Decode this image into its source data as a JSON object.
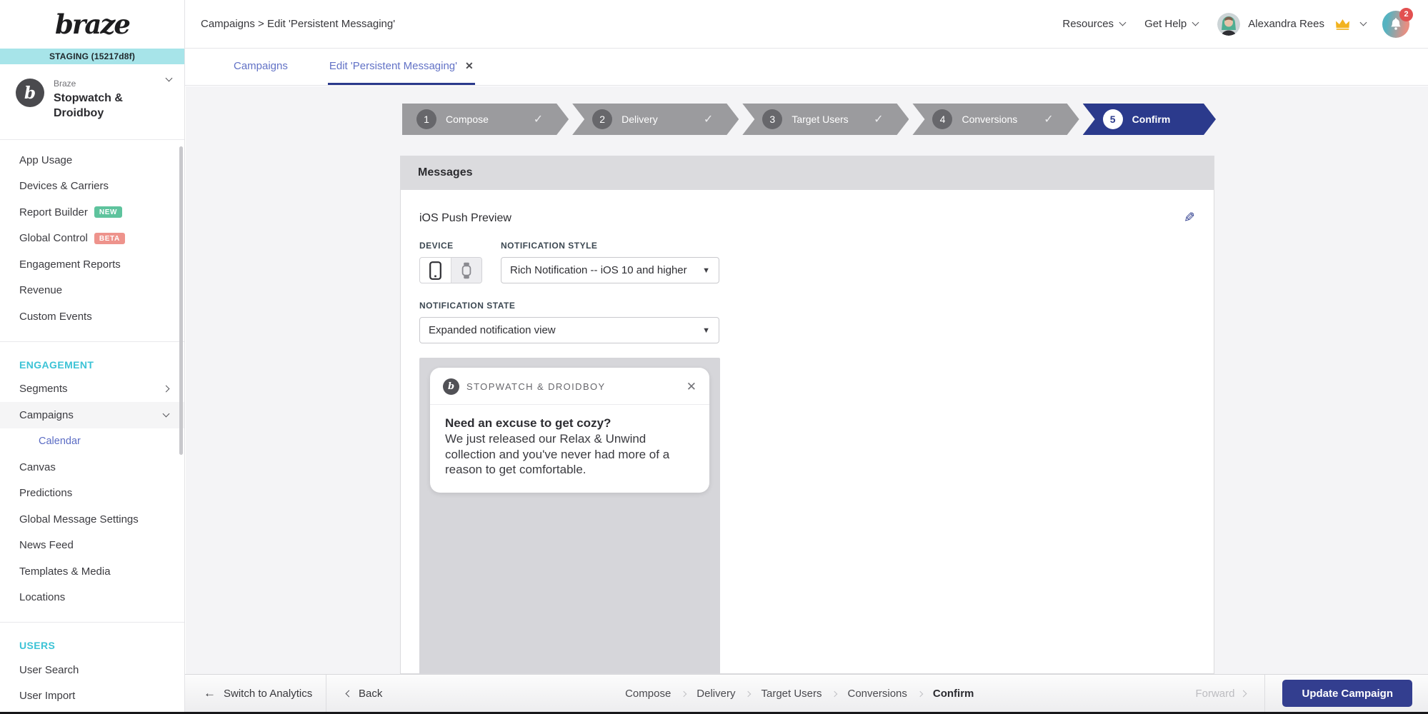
{
  "brand": {
    "logo_text": "braze",
    "env_badge": "STAGING (15217d8f)"
  },
  "workspace": {
    "org": "Braze",
    "app_group": "Stopwatch & Droidboy",
    "avatar_letter": "b"
  },
  "header": {
    "breadcrumb": "Campaigns > Edit 'Persistent Messaging'",
    "resources_label": "Resources",
    "get_help_label": "Get Help",
    "user_name": "Alexandra Rees",
    "notification_count": "2"
  },
  "tabs": [
    {
      "label": "Campaigns",
      "active": false
    },
    {
      "label": "Edit 'Persistent Messaging'",
      "active": true
    }
  ],
  "wizard": {
    "steps": [
      {
        "num": "1",
        "label": "Compose",
        "state": "done"
      },
      {
        "num": "2",
        "label": "Delivery",
        "state": "done"
      },
      {
        "num": "3",
        "label": "Target Users",
        "state": "done"
      },
      {
        "num": "4",
        "label": "Conversions",
        "state": "done"
      },
      {
        "num": "5",
        "label": "Confirm",
        "state": "active"
      }
    ]
  },
  "sidebar": {
    "analytics": [
      {
        "label": "App Usage"
      },
      {
        "label": "Devices & Carriers"
      },
      {
        "label": "Report Builder",
        "badge": "NEW"
      },
      {
        "label": "Global Control",
        "badge": "BETA"
      },
      {
        "label": "Engagement Reports"
      },
      {
        "label": "Revenue"
      },
      {
        "label": "Custom Events"
      }
    ],
    "engagement_header": "ENGAGEMENT",
    "engagement": [
      {
        "label": "Segments"
      },
      {
        "label": "Campaigns",
        "active": true
      },
      {
        "label": "Calendar",
        "sub": true
      },
      {
        "label": "Canvas"
      },
      {
        "label": "Predictions"
      },
      {
        "label": "Global Message Settings"
      },
      {
        "label": "News Feed"
      },
      {
        "label": "Templates & Media"
      },
      {
        "label": "Locations"
      }
    ],
    "users_header": "USERS",
    "users": [
      {
        "label": "User Search"
      },
      {
        "label": "User Import"
      }
    ]
  },
  "messages_panel": {
    "title": "Messages",
    "preview_title": "iOS Push Preview",
    "device_label": "DEVICE",
    "notification_style_label": "NOTIFICATION STYLE",
    "notification_style_value": "Rich Notification -- iOS 10 and higher",
    "notification_state_label": "NOTIFICATION STATE",
    "notification_state_value": "Expanded notification view",
    "push_preview": {
      "app_name": "STOPWATCH & DROIDBOY",
      "title": "Need an excuse to get cozy?",
      "body": "We just released our Relax & Unwind collection and you've never had more of a reason to get comfortable."
    }
  },
  "footer": {
    "switch_label": "Switch to Analytics",
    "back_label": "Back",
    "steps": [
      "Compose",
      "Delivery",
      "Target Users",
      "Conversions",
      "Confirm"
    ],
    "active_step": "Confirm",
    "forward_label": "Forward",
    "update_label": "Update Campaign"
  },
  "icons": {
    "check": "✓",
    "close": "✕",
    "caret_down": "▼",
    "arrow_left": "←",
    "pencil": "✎"
  },
  "colors": {
    "primary_navy": "#2b3a8c",
    "link_blue": "#6272c6",
    "teal_header": "#3cc3d6",
    "staging_bg": "#a7e4e9",
    "badge_new": "#5ec39d",
    "badge_beta": "#ee938c",
    "wizard_gray": "#9b9b9e",
    "notification_badge_red": "#e25050"
  }
}
